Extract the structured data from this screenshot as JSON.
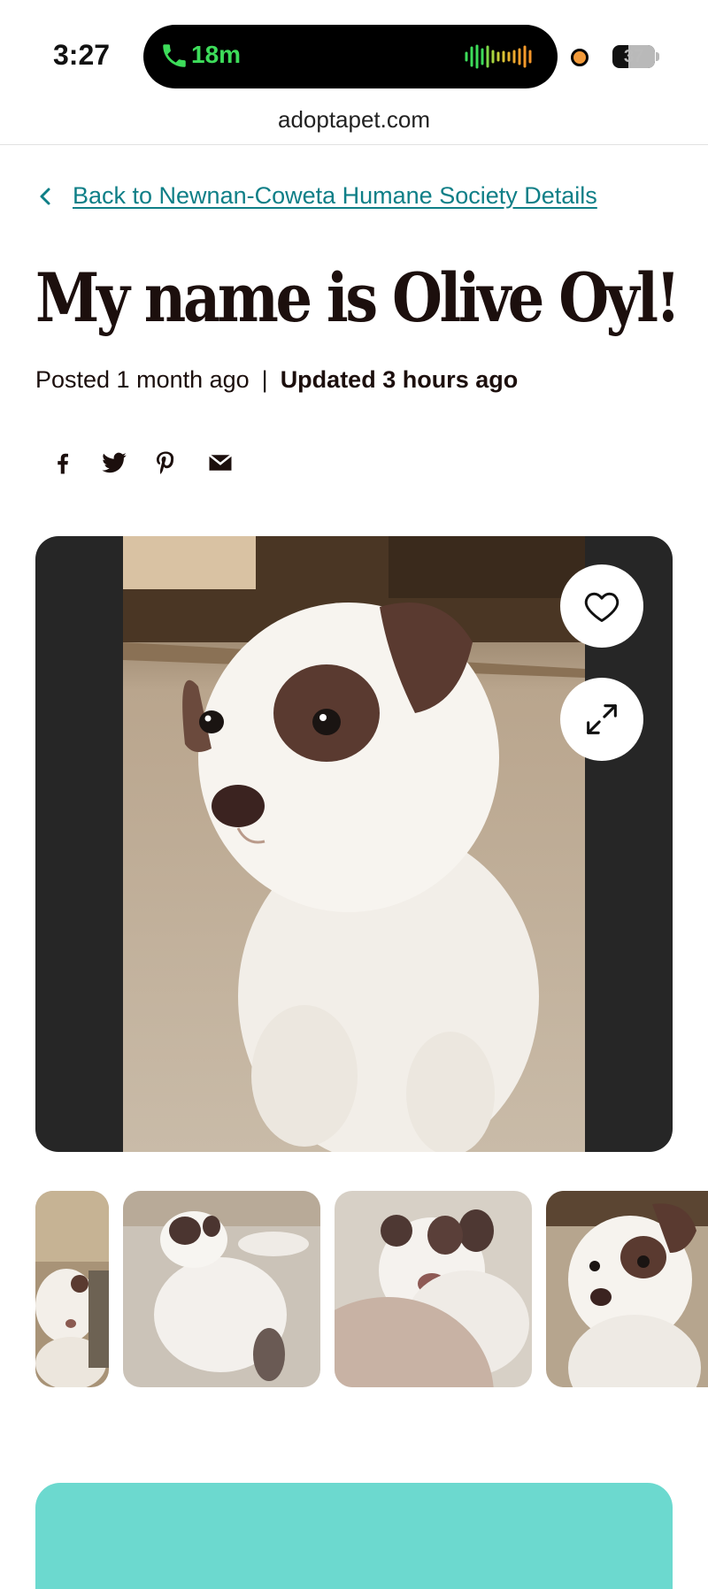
{
  "status_bar": {
    "time": "3:27",
    "call_duration": "18m",
    "battery": "37",
    "battery_level": 0.37
  },
  "browser": {
    "url": "adoptapet.com"
  },
  "back_link": {
    "label": "Back to Newnan-Coweta Humane Society Details"
  },
  "pet": {
    "title": "My name is Olive Oyl!",
    "posted": "Posted 1 month ago",
    "separator": "|",
    "updated": "Updated 3 hours ago"
  },
  "share": {
    "icons": [
      "facebook-icon",
      "twitter-icon",
      "pinterest-icon",
      "email-icon"
    ]
  },
  "gallery": {
    "buttons": [
      "heart-icon",
      "expand-icon"
    ],
    "thumbnail_count": 4
  },
  "colors": {
    "link": "#0f7f87",
    "title": "#1c0f0d",
    "cta": "#6cd9cf",
    "call_green": "#3ddc5a",
    "gallery_bg": "#262626"
  }
}
